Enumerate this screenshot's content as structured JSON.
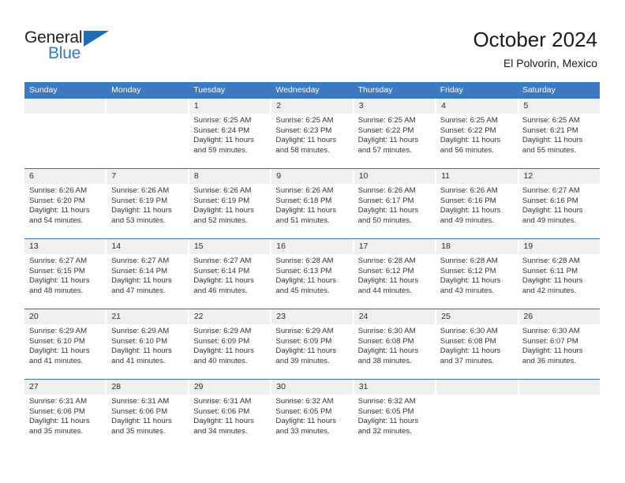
{
  "brand": {
    "name_top": "General",
    "name_bottom": "Blue",
    "triangle_color": "#1f6fb6",
    "text_color": "#231f20",
    "blue_color": "#2e7cc4"
  },
  "header": {
    "title": "October 2024",
    "subtitle": "El Polvorin, Mexico"
  },
  "colors": {
    "header_row_bg": "#3b7ac0",
    "header_row_text": "#ffffff",
    "date_band_bg": "#efefef",
    "cell_bg": "#ffffff",
    "row_separator": "#2f6fb5",
    "body_text": "#333333"
  },
  "weekdays": [
    "Sunday",
    "Monday",
    "Tuesday",
    "Wednesday",
    "Thursday",
    "Friday",
    "Saturday"
  ],
  "weeks": [
    {
      "days": [
        {
          "date": "",
          "lines": []
        },
        {
          "date": "",
          "lines": []
        },
        {
          "date": "1",
          "lines": [
            "Sunrise: 6:25 AM",
            "Sunset: 6:24 PM",
            "Daylight: 11 hours",
            "and 59 minutes."
          ]
        },
        {
          "date": "2",
          "lines": [
            "Sunrise: 6:25 AM",
            "Sunset: 6:23 PM",
            "Daylight: 11 hours",
            "and 58 minutes."
          ]
        },
        {
          "date": "3",
          "lines": [
            "Sunrise: 6:25 AM",
            "Sunset: 6:22 PM",
            "Daylight: 11 hours",
            "and 57 minutes."
          ]
        },
        {
          "date": "4",
          "lines": [
            "Sunrise: 6:25 AM",
            "Sunset: 6:22 PM",
            "Daylight: 11 hours",
            "and 56 minutes."
          ]
        },
        {
          "date": "5",
          "lines": [
            "Sunrise: 6:25 AM",
            "Sunset: 6:21 PM",
            "Daylight: 11 hours",
            "and 55 minutes."
          ]
        }
      ]
    },
    {
      "days": [
        {
          "date": "6",
          "lines": [
            "Sunrise: 6:26 AM",
            "Sunset: 6:20 PM",
            "Daylight: 11 hours",
            "and 54 minutes."
          ]
        },
        {
          "date": "7",
          "lines": [
            "Sunrise: 6:26 AM",
            "Sunset: 6:19 PM",
            "Daylight: 11 hours",
            "and 53 minutes."
          ]
        },
        {
          "date": "8",
          "lines": [
            "Sunrise: 6:26 AM",
            "Sunset: 6:19 PM",
            "Daylight: 11 hours",
            "and 52 minutes."
          ]
        },
        {
          "date": "9",
          "lines": [
            "Sunrise: 6:26 AM",
            "Sunset: 6:18 PM",
            "Daylight: 11 hours",
            "and 51 minutes."
          ]
        },
        {
          "date": "10",
          "lines": [
            "Sunrise: 6:26 AM",
            "Sunset: 6:17 PM",
            "Daylight: 11 hours",
            "and 50 minutes."
          ]
        },
        {
          "date": "11",
          "lines": [
            "Sunrise: 6:26 AM",
            "Sunset: 6:16 PM",
            "Daylight: 11 hours",
            "and 49 minutes."
          ]
        },
        {
          "date": "12",
          "lines": [
            "Sunrise: 6:27 AM",
            "Sunset: 6:16 PM",
            "Daylight: 11 hours",
            "and 49 minutes."
          ]
        }
      ]
    },
    {
      "days": [
        {
          "date": "13",
          "lines": [
            "Sunrise: 6:27 AM",
            "Sunset: 6:15 PM",
            "Daylight: 11 hours",
            "and 48 minutes."
          ]
        },
        {
          "date": "14",
          "lines": [
            "Sunrise: 6:27 AM",
            "Sunset: 6:14 PM",
            "Daylight: 11 hours",
            "and 47 minutes."
          ]
        },
        {
          "date": "15",
          "lines": [
            "Sunrise: 6:27 AM",
            "Sunset: 6:14 PM",
            "Daylight: 11 hours",
            "and 46 minutes."
          ]
        },
        {
          "date": "16",
          "lines": [
            "Sunrise: 6:28 AM",
            "Sunset: 6:13 PM",
            "Daylight: 11 hours",
            "and 45 minutes."
          ]
        },
        {
          "date": "17",
          "lines": [
            "Sunrise: 6:28 AM",
            "Sunset: 6:12 PM",
            "Daylight: 11 hours",
            "and 44 minutes."
          ]
        },
        {
          "date": "18",
          "lines": [
            "Sunrise: 6:28 AM",
            "Sunset: 6:12 PM",
            "Daylight: 11 hours",
            "and 43 minutes."
          ]
        },
        {
          "date": "19",
          "lines": [
            "Sunrise: 6:28 AM",
            "Sunset: 6:11 PM",
            "Daylight: 11 hours",
            "and 42 minutes."
          ]
        }
      ]
    },
    {
      "days": [
        {
          "date": "20",
          "lines": [
            "Sunrise: 6:29 AM",
            "Sunset: 6:10 PM",
            "Daylight: 11 hours",
            "and 41 minutes."
          ]
        },
        {
          "date": "21",
          "lines": [
            "Sunrise: 6:29 AM",
            "Sunset: 6:10 PM",
            "Daylight: 11 hours",
            "and 41 minutes."
          ]
        },
        {
          "date": "22",
          "lines": [
            "Sunrise: 6:29 AM",
            "Sunset: 6:09 PM",
            "Daylight: 11 hours",
            "and 40 minutes."
          ]
        },
        {
          "date": "23",
          "lines": [
            "Sunrise: 6:29 AM",
            "Sunset: 6:09 PM",
            "Daylight: 11 hours",
            "and 39 minutes."
          ]
        },
        {
          "date": "24",
          "lines": [
            "Sunrise: 6:30 AM",
            "Sunset: 6:08 PM",
            "Daylight: 11 hours",
            "and 38 minutes."
          ]
        },
        {
          "date": "25",
          "lines": [
            "Sunrise: 6:30 AM",
            "Sunset: 6:08 PM",
            "Daylight: 11 hours",
            "and 37 minutes."
          ]
        },
        {
          "date": "26",
          "lines": [
            "Sunrise: 6:30 AM",
            "Sunset: 6:07 PM",
            "Daylight: 11 hours",
            "and 36 minutes."
          ]
        }
      ]
    },
    {
      "days": [
        {
          "date": "27",
          "lines": [
            "Sunrise: 6:31 AM",
            "Sunset: 6:06 PM",
            "Daylight: 11 hours",
            "and 35 minutes."
          ]
        },
        {
          "date": "28",
          "lines": [
            "Sunrise: 6:31 AM",
            "Sunset: 6:06 PM",
            "Daylight: 11 hours",
            "and 35 minutes."
          ]
        },
        {
          "date": "29",
          "lines": [
            "Sunrise: 6:31 AM",
            "Sunset: 6:06 PM",
            "Daylight: 11 hours",
            "and 34 minutes."
          ]
        },
        {
          "date": "30",
          "lines": [
            "Sunrise: 6:32 AM",
            "Sunset: 6:05 PM",
            "Daylight: 11 hours",
            "and 33 minutes."
          ]
        },
        {
          "date": "31",
          "lines": [
            "Sunrise: 6:32 AM",
            "Sunset: 6:05 PM",
            "Daylight: 11 hours",
            "and 32 minutes."
          ]
        },
        {
          "date": "",
          "lines": []
        },
        {
          "date": "",
          "lines": []
        }
      ]
    }
  ]
}
